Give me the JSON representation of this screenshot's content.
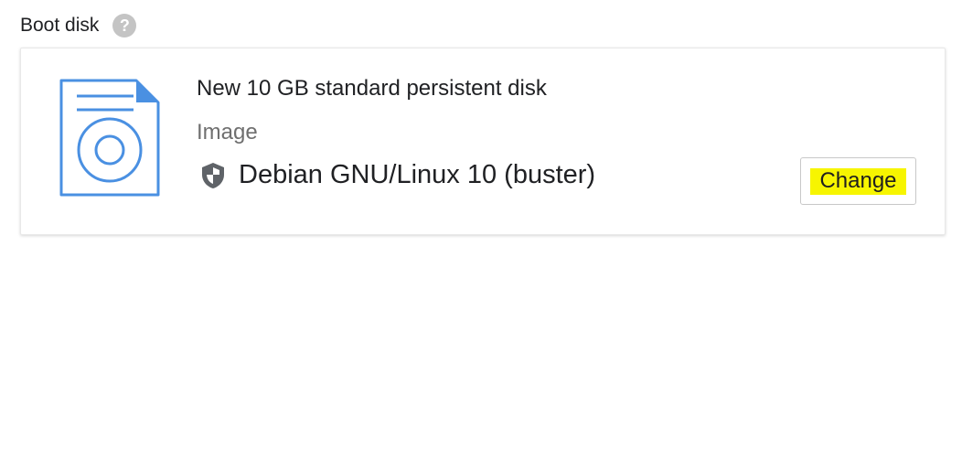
{
  "section": {
    "label": "Boot disk",
    "help_glyph": "?",
    "help_icon": "help-circle-icon"
  },
  "disk": {
    "title": "New 10 GB standard persistent disk",
    "image_label": "Image",
    "os_name": "Debian GNU/Linux 10 (buster)",
    "os_icon": "shield-icon",
    "illustration_icon": "disk-file-icon"
  },
  "actions": {
    "change_label": "Change"
  },
  "colors": {
    "accent_blue": "#4a90e2",
    "icon_gray": "#5f6368",
    "highlight_yellow": "#f7f500",
    "help_gray": "#c4c4c4"
  }
}
